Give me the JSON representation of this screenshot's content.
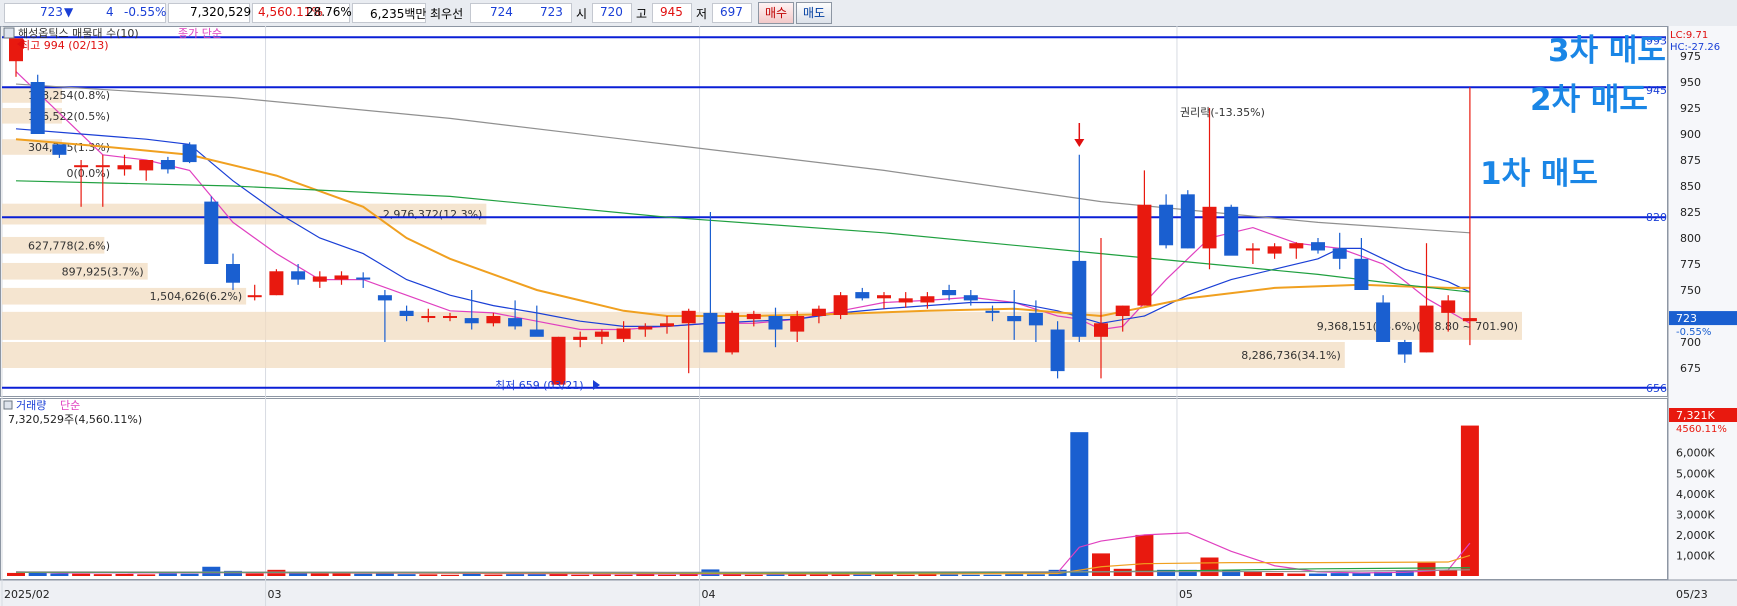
{
  "topbar": {
    "price": "723",
    "arrow": "▼",
    "change": "4",
    "change_pct": "-0.55%",
    "volume": "7,320,529",
    "volume_pct": "4,560.11%",
    "turnover": "28.76%",
    "amount": "6,235백만",
    "best_ask_label": "최우선",
    "best_ask": "724",
    "best_bid": "723",
    "open_label": "시",
    "open": "720",
    "high_label": "고",
    "high": "945",
    "low_label": "저",
    "low": "697",
    "buy_label": "매수",
    "sell_label": "매도"
  },
  "price_panel": {
    "title": "해성옵틱스 매물대 수(10)",
    "ma_legend_label": "종가 단순",
    "ma_periods": [
      "5",
      "10",
      "20",
      "60",
      "120"
    ],
    "ma_colors": [
      "#e040c0",
      "#1a3fd6",
      "#f0a020",
      "#20a040",
      "#909090"
    ],
    "high_label": "최고 994 (02/13)",
    "low_label": "최저 659 (03/21)",
    "event_label": "권리락(-13.35%)",
    "lc_label": "LC:9.71",
    "hc_label": "HC:-27.26",
    "annotations": [
      "3차 매도",
      "2차 매도",
      "1차 매도"
    ],
    "current_price": "723",
    "current_change": "-0.55%",
    "levels": [
      "993",
      "945",
      "820",
      "656"
    ]
  },
  "volume_panel": {
    "title": "거래량",
    "ma_legend_label": "단순",
    "ma_periods": [
      "5",
      "20",
      "60",
      "120"
    ],
    "ma_colors": [
      "#e040c0",
      "#f0a020",
      "#20a040",
      "#909090"
    ],
    "summary": "7,320,529주(4,560.11%)",
    "current_value": "7,321K",
    "current_pct": "4560.11%"
  },
  "chart_data": {
    "type": "candlestick",
    "price_axis": {
      "ticks": [
        675,
        700,
        725,
        750,
        775,
        800,
        825,
        850,
        875,
        900,
        925,
        950,
        975
      ],
      "ylim": [
        650,
        1000
      ]
    },
    "volume_axis": {
      "ticks": [
        "1,000K",
        "2,000K",
        "3,000K",
        "4,000K",
        "5,000K",
        "6,000K"
      ],
      "ylim": [
        0,
        7300
      ]
    },
    "x_labels": [
      "2025/02",
      "03",
      "04",
      "05",
      "05/23"
    ],
    "candles": [
      {
        "o": 970,
        "h": 985,
        "l": 955,
        "c": 992
      },
      {
        "o": 950,
        "h": 957,
        "l": 900,
        "c": 900
      },
      {
        "o": 890,
        "h": 890,
        "l": 877,
        "c": 880
      },
      {
        "o": 870,
        "h": 875,
        "l": 830,
        "c": 870
      },
      {
        "o": 870,
        "h": 880,
        "l": 830,
        "c": 870
      },
      {
        "o": 866,
        "h": 880,
        "l": 860,
        "c": 870
      },
      {
        "o": 865,
        "h": 875,
        "l": 855,
        "c": 875
      },
      {
        "o": 875,
        "h": 878,
        "l": 862,
        "c": 866
      },
      {
        "o": 890,
        "h": 892,
        "l": 872,
        "c": 873
      },
      {
        "o": 835,
        "h": 840,
        "l": 775,
        "c": 775
      },
      {
        "o": 775,
        "h": 785,
        "l": 750,
        "c": 757
      },
      {
        "o": 745,
        "h": 755,
        "l": 740,
        "c": 745
      },
      {
        "o": 745,
        "h": 770,
        "l": 745,
        "c": 768
      },
      {
        "o": 768,
        "h": 775,
        "l": 755,
        "c": 760
      },
      {
        "o": 758,
        "h": 768,
        "l": 752,
        "c": 763
      },
      {
        "o": 760,
        "h": 768,
        "l": 755,
        "c": 764
      },
      {
        "o": 762,
        "h": 767,
        "l": 752,
        "c": 760
      },
      {
        "o": 745,
        "h": 750,
        "l": 700,
        "c": 740
      },
      {
        "o": 730,
        "h": 735,
        "l": 720,
        "c": 725
      },
      {
        "o": 725,
        "h": 732,
        "l": 719,
        "c": 725
      },
      {
        "o": 725,
        "h": 728,
        "l": 720,
        "c": 725
      },
      {
        "o": 723,
        "h": 750,
        "l": 712,
        "c": 718
      },
      {
        "o": 718,
        "h": 728,
        "l": 715,
        "c": 725
      },
      {
        "o": 723,
        "h": 740,
        "l": 712,
        "c": 715
      },
      {
        "o": 712,
        "h": 735,
        "l": 708,
        "c": 705
      },
      {
        "o": 659,
        "h": 705,
        "l": 659,
        "c": 705
      },
      {
        "o": 702,
        "h": 710,
        "l": 695,
        "c": 705
      },
      {
        "o": 705,
        "h": 712,
        "l": 698,
        "c": 710
      },
      {
        "o": 703,
        "h": 720,
        "l": 700,
        "c": 713
      },
      {
        "o": 712,
        "h": 718,
        "l": 705,
        "c": 715
      },
      {
        "o": 715,
        "h": 725,
        "l": 708,
        "c": 718
      },
      {
        "o": 718,
        "h": 732,
        "l": 670,
        "c": 730
      },
      {
        "o": 728,
        "h": 825,
        "l": 710,
        "c": 690
      },
      {
        "o": 690,
        "h": 730,
        "l": 688,
        "c": 728
      },
      {
        "o": 722,
        "h": 730,
        "l": 715,
        "c": 727
      },
      {
        "o": 725,
        "h": 733,
        "l": 695,
        "c": 712
      },
      {
        "o": 710,
        "h": 730,
        "l": 700,
        "c": 725
      },
      {
        "o": 725,
        "h": 735,
        "l": 718,
        "c": 732
      },
      {
        "o": 726,
        "h": 748,
        "l": 722,
        "c": 745
      },
      {
        "o": 748,
        "h": 752,
        "l": 740,
        "c": 742
      },
      {
        "o": 742,
        "h": 748,
        "l": 732,
        "c": 745
      },
      {
        "o": 738,
        "h": 748,
        "l": 733,
        "c": 742
      },
      {
        "o": 738,
        "h": 748,
        "l": 732,
        "c": 744
      },
      {
        "o": 750,
        "h": 755,
        "l": 740,
        "c": 745
      },
      {
        "o": 745,
        "h": 750,
        "l": 735,
        "c": 740
      },
      {
        "o": 730,
        "h": 735,
        "l": 720,
        "c": 728
      },
      {
        "o": 725,
        "h": 750,
        "l": 702,
        "c": 720
      },
      {
        "o": 728,
        "h": 740,
        "l": 700,
        "c": 716
      },
      {
        "o": 712,
        "h": 720,
        "l": 665,
        "c": 672
      },
      {
        "o": 778,
        "h": 880,
        "l": 700,
        "c": 705
      },
      {
        "o": 705,
        "h": 800,
        "l": 665,
        "c": 718
      },
      {
        "o": 725,
        "h": 735,
        "l": 710,
        "c": 735
      },
      {
        "o": 735,
        "h": 865,
        "l": 735,
        "c": 832
      },
      {
        "o": 832,
        "h": 842,
        "l": 790,
        "c": 793
      },
      {
        "o": 842,
        "h": 846,
        "l": 790,
        "c": 790
      },
      {
        "o": 790,
        "h": 925,
        "l": 770,
        "c": 830
      },
      {
        "o": 830,
        "h": 832,
        "l": 785,
        "c": 783
      },
      {
        "o": 788,
        "h": 795,
        "l": 775,
        "c": 790
      },
      {
        "o": 785,
        "h": 795,
        "l": 780,
        "c": 792
      },
      {
        "o": 790,
        "h": 796,
        "l": 780,
        "c": 795
      },
      {
        "o": 796,
        "h": 800,
        "l": 785,
        "c": 788
      },
      {
        "o": 790,
        "h": 805,
        "l": 770,
        "c": 780
      },
      {
        "o": 780,
        "h": 800,
        "l": 755,
        "c": 750
      },
      {
        "o": 738,
        "h": 745,
        "l": 715,
        "c": 700
      },
      {
        "o": 700,
        "h": 702,
        "l": 680,
        "c": 688
      },
      {
        "o": 690,
        "h": 795,
        "l": 690,
        "c": 735
      },
      {
        "o": 728,
        "h": 745,
        "l": 710,
        "c": 740
      },
      {
        "o": 720,
        "h": 945,
        "l": 697,
        "c": 723
      }
    ],
    "volumes_k": [
      150,
      180,
      120,
      110,
      90,
      100,
      80,
      120,
      110,
      450,
      250,
      120,
      300,
      150,
      120,
      130,
      110,
      150,
      90,
      80,
      60,
      120,
      70,
      90,
      90,
      150,
      60,
      70,
      60,
      80,
      60,
      90,
      320,
      110,
      60,
      70,
      80,
      90,
      110,
      70,
      80,
      60,
      90,
      70,
      60,
      60,
      90,
      80,
      300,
      7000,
      1100,
      350,
      2000,
      300,
      300,
      900,
      280,
      200,
      150,
      120,
      120,
      140,
      140,
      200,
      250,
      650,
      290,
      7321
    ],
    "ma": {
      "ma5": [
        [
          0,
          960
        ],
        [
          2,
          920
        ],
        [
          4,
          880
        ],
        [
          6,
          875
        ],
        [
          8,
          865
        ],
        [
          10,
          815
        ],
        [
          12,
          785
        ],
        [
          14,
          760
        ],
        [
          16,
          760
        ],
        [
          18,
          745
        ],
        [
          20,
          730
        ],
        [
          22,
          728
        ],
        [
          24,
          720
        ],
        [
          26,
          712
        ],
        [
          28,
          712
        ],
        [
          30,
          715
        ],
        [
          32,
          718
        ],
        [
          34,
          718
        ],
        [
          36,
          722
        ],
        [
          38,
          730
        ],
        [
          40,
          738
        ],
        [
          42,
          740
        ],
        [
          44,
          743
        ],
        [
          46,
          738
        ],
        [
          48,
          725
        ],
        [
          49,
          722
        ],
        [
          50,
          712
        ],
        [
          51,
          715
        ],
        [
          53,
          760
        ],
        [
          55,
          800
        ],
        [
          57,
          810
        ],
        [
          59,
          795
        ],
        [
          61,
          790
        ],
        [
          63,
          775
        ],
        [
          65,
          742
        ],
        [
          67,
          718
        ]
      ],
      "ma10": [
        [
          0,
          905
        ],
        [
          3,
          900
        ],
        [
          6,
          895
        ],
        [
          8,
          890
        ],
        [
          10,
          855
        ],
        [
          12,
          825
        ],
        [
          14,
          800
        ],
        [
          16,
          785
        ],
        [
          18,
          760
        ],
        [
          20,
          745
        ],
        [
          22,
          735
        ],
        [
          24,
          728
        ],
        [
          26,
          720
        ],
        [
          28,
          715
        ],
        [
          30,
          715
        ],
        [
          32,
          718
        ],
        [
          34,
          720
        ],
        [
          36,
          722
        ],
        [
          38,
          728
        ],
        [
          40,
          732
        ],
        [
          42,
          735
        ],
        [
          44,
          738
        ],
        [
          46,
          738
        ],
        [
          48,
          730
        ],
        [
          50,
          718
        ],
        [
          52,
          725
        ],
        [
          54,
          745
        ],
        [
          56,
          760
        ],
        [
          58,
          770
        ],
        [
          60,
          780
        ],
        [
          61,
          790
        ],
        [
          62,
          790
        ],
        [
          64,
          770
        ],
        [
          66,
          758
        ],
        [
          67,
          748
        ]
      ],
      "ma20": [
        [
          0,
          895
        ],
        [
          4,
          888
        ],
        [
          8,
          880
        ],
        [
          12,
          860
        ],
        [
          16,
          830
        ],
        [
          18,
          800
        ],
        [
          20,
          780
        ],
        [
          22,
          765
        ],
        [
          24,
          750
        ],
        [
          26,
          740
        ],
        [
          28,
          730
        ],
        [
          30,
          725
        ],
        [
          34,
          725
        ],
        [
          38,
          727
        ],
        [
          42,
          730
        ],
        [
          46,
          732
        ],
        [
          50,
          725
        ],
        [
          54,
          742
        ],
        [
          58,
          752
        ],
        [
          62,
          755
        ],
        [
          66,
          752
        ],
        [
          67,
          752
        ]
      ],
      "ma60": [
        [
          0,
          855
        ],
        [
          10,
          850
        ],
        [
          20,
          840
        ],
        [
          30,
          820
        ],
        [
          40,
          805
        ],
        [
          50,
          785
        ],
        [
          55,
          775
        ],
        [
          60,
          765
        ],
        [
          64,
          755
        ],
        [
          67,
          748
        ]
      ],
      "ma120": [
        [
          0,
          948
        ],
        [
          10,
          935
        ],
        [
          20,
          915
        ],
        [
          30,
          890
        ],
        [
          40,
          865
        ],
        [
          50,
          835
        ],
        [
          60,
          815
        ],
        [
          67,
          805
        ]
      ],
      "vma5": [
        [
          0,
          200
        ],
        [
          2,
          150
        ],
        [
          10,
          160
        ],
        [
          20,
          130
        ],
        [
          30,
          100
        ],
        [
          40,
          90
        ],
        [
          48,
          160
        ],
        [
          49,
          1400
        ],
        [
          50,
          1700
        ],
        [
          52,
          2000
        ],
        [
          54,
          2100
        ],
        [
          56,
          1200
        ],
        [
          58,
          500
        ],
        [
          60,
          200
        ],
        [
          62,
          150
        ],
        [
          64,
          180
        ],
        [
          66,
          300
        ],
        [
          67,
          1600
        ]
      ],
      "vma20": [
        [
          0,
          180
        ],
        [
          10,
          170
        ],
        [
          20,
          150
        ],
        [
          30,
          130
        ],
        [
          40,
          100
        ],
        [
          48,
          120
        ],
        [
          50,
          450
        ],
        [
          52,
          600
        ],
        [
          56,
          650
        ],
        [
          60,
          650
        ],
        [
          66,
          680
        ],
        [
          67,
          1000
        ]
      ],
      "vma60": [
        [
          0,
          180
        ],
        [
          20,
          170
        ],
        [
          40,
          150
        ],
        [
          50,
          200
        ],
        [
          60,
          350
        ],
        [
          67,
          400
        ]
      ],
      "vma120": [
        [
          0,
          200
        ],
        [
          30,
          180
        ],
        [
          60,
          220
        ],
        [
          67,
          300
        ]
      ]
    },
    "volume_profile": [
      {
        "label": "198,254(0.8%)",
        "pct": 0.8,
        "price_lo": 930,
        "price_hi": 945
      },
      {
        "label": "136,522(0.5%)",
        "pct": 0.5,
        "price_lo": 910,
        "price_hi": 925
      },
      {
        "label": "304,345(1.3%)",
        "pct": 1.3,
        "price_lo": 880,
        "price_hi": 895
      },
      {
        "label": "0(0.0%)",
        "pct": 0.0,
        "price_lo": 855,
        "price_hi": 870
      },
      {
        "label": "2,976,372(12.3%)",
        "pct": 12.3,
        "price_lo": 813,
        "price_hi": 833
      },
      {
        "label": "627,778(2.6%)",
        "pct": 2.6,
        "price_lo": 785,
        "price_hi": 801
      },
      {
        "label": "897,925(3.7%)",
        "pct": 3.7,
        "price_lo": 760,
        "price_hi": 776
      },
      {
        "label": "1,504,626(6.2%)",
        "pct": 6.2,
        "price_lo": 736,
        "price_hi": 752
      },
      {
        "label": "9,368,151(38.6%)(728.80 ~ 701.90)",
        "pct": 38.6,
        "price_lo": 702,
        "price_hi": 729
      },
      {
        "label": "8,286,736(34.1%)",
        "pct": 34.1,
        "price_lo": 675,
        "price_hi": 700
      }
    ]
  }
}
